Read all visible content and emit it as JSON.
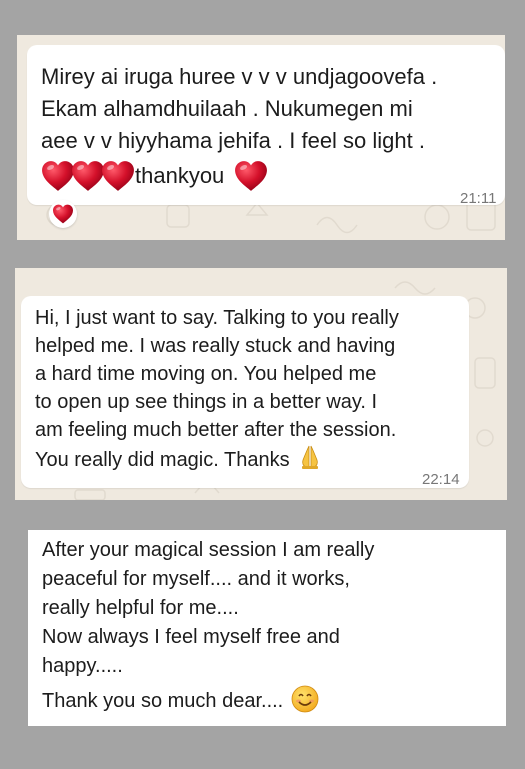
{
  "messages": [
    {
      "lines": [
        "Mirey ai iruga huree v v v undjagoovefa .",
        "Ekam alhamdhuilaah . Nukumegen mi",
        "aee v v hiyyhama jehifa . I feel so light ."
      ],
      "hearts_text": "thankyou",
      "time": "21:11",
      "reaction": "heart-icon"
    },
    {
      "lines": [
        "Hi, I just want to say. Talking to you really",
        "helped me. I was really stuck and having",
        "a hard time moving on. You helped me",
        "to open up see things in a better way. I",
        "am feeling much better after the session.",
        "You really did magic. Thanks"
      ],
      "emoji": "folded-hands-icon",
      "time": "22:14"
    },
    {
      "lines": [
        "After  your magical  session  I am really",
        "peaceful  for myself.... and  it works,",
        "really helpful  for  me....",
        "Now always I  feel  myself free and",
        "happy.....",
        "Thank you so much dear...."
      ],
      "emoji": "smiling-face-icon"
    }
  ],
  "colors": {
    "background": "#a4a4a4",
    "chat_wallpaper": "#efe9df",
    "bubble": "#ffffff",
    "heart": "#c8102e",
    "text": "#1c1c1c",
    "timestamp": "#777777"
  }
}
